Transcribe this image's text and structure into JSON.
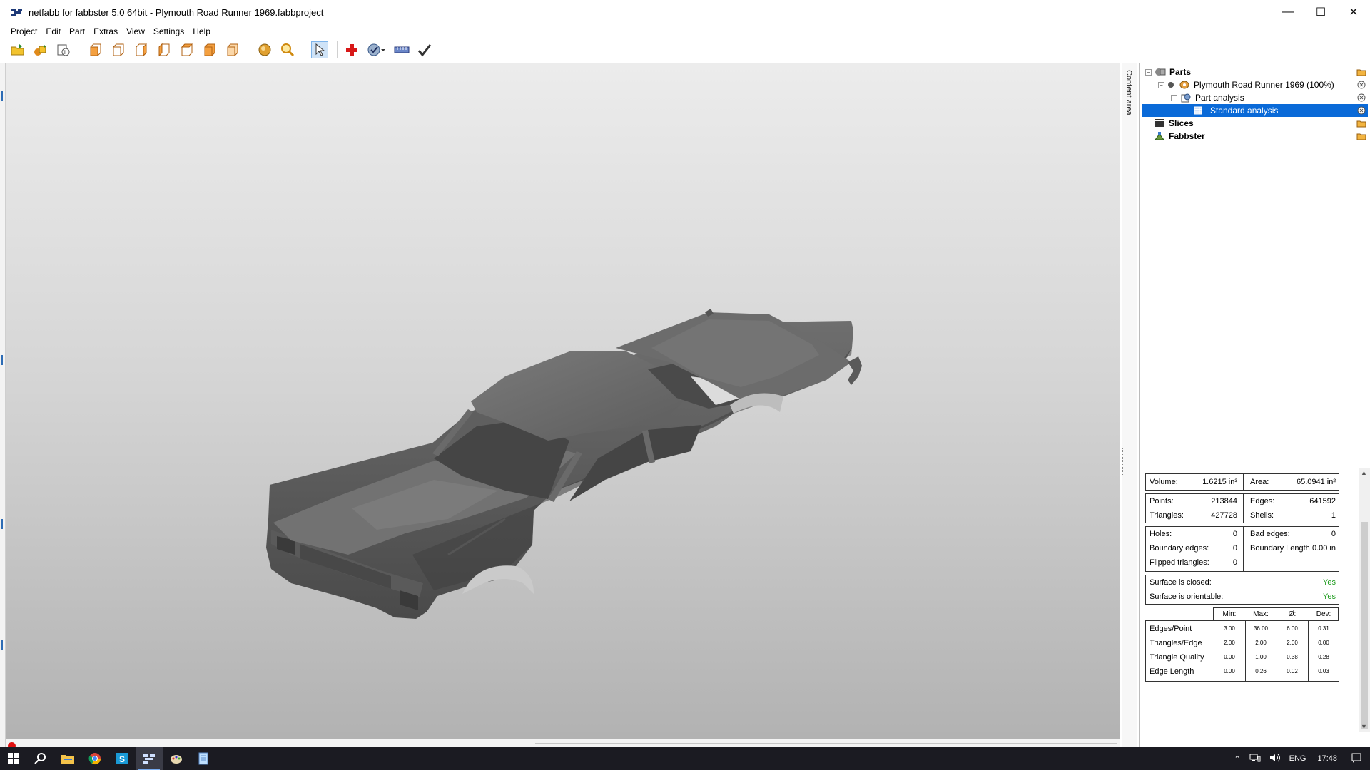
{
  "window": {
    "title": "netfabb for fabbster 5.0 64bit - Plymouth Road Runner 1969.fabbproject",
    "minimize": "—",
    "maximize": "☐",
    "close": "✕"
  },
  "menu": [
    "Project",
    "Edit",
    "Part",
    "Extras",
    "View",
    "Settings",
    "Help"
  ],
  "toolbar_icons": [
    "open-project-icon",
    "add-part-icon",
    "part-info-icon",
    "view-front-icon",
    "view-back-icon",
    "view-left-icon",
    "view-right-icon",
    "view-top-icon",
    "view-bottom-icon",
    "view-iso-icon",
    "shading-icon",
    "zoom-icon",
    "select-tool-icon",
    "repair-icon",
    "measure-icon",
    "ruler-icon",
    "check-icon"
  ],
  "sidetab": {
    "label": "Content area"
  },
  "tree": {
    "parts": "Parts",
    "part_name": "Plymouth Road Runner 1969 (100%)",
    "part_analysis": "Part analysis",
    "standard_analysis": "Standard analysis",
    "slices": "Slices",
    "fabbster": "Fabbster"
  },
  "stats": {
    "volume_label": "Volume:",
    "volume": "1.6215 in³",
    "area_label": "Area:",
    "area": "65.0941 in²",
    "points_label": "Points:",
    "points": "213844",
    "edges_label": "Edges:",
    "edges": "641592",
    "triangles_label": "Triangles:",
    "triangles": "427728",
    "shells_label": "Shells:",
    "shells": "1",
    "holes_label": "Holes:",
    "holes": "0",
    "bad_edges_label": "Bad edges:",
    "bad_edges": "0",
    "boundary_edges_label": "Boundary edges:",
    "boundary_edges": "0",
    "boundary_length_label": "Boundary Length",
    "boundary_length": "0.00 in",
    "flipped_label": "Flipped triangles:",
    "flipped": "0",
    "closed_label": "Surface is closed:",
    "closed": "Yes",
    "orientable_label": "Surface is orientable:",
    "orientable": "Yes",
    "table_headers": [
      "Min:",
      "Max:",
      "Ø:",
      "Dev:"
    ],
    "table_rows": [
      {
        "label": "Edges/Point",
        "values": [
          "3.00",
          "36.00",
          "6.00",
          "0.31"
        ]
      },
      {
        "label": "Triangles/Edge",
        "values": [
          "2.00",
          "2.00",
          "2.00",
          "0.00"
        ]
      },
      {
        "label": "Triangle Quality",
        "values": [
          "0.00",
          "1.00",
          "0.38",
          "0.28"
        ]
      },
      {
        "label": "Edge Length",
        "values": [
          "0.00",
          "0.26",
          "0.02",
          "0.03"
        ]
      }
    ]
  },
  "taskbar": {
    "apps": [
      "start-icon",
      "search-icon",
      "file-explorer-icon",
      "chrome-icon",
      "app-s-icon",
      "netfabb-icon",
      "paint-icon",
      "notepad-icon"
    ],
    "tray_language": "ENG",
    "tray_time": "17:48"
  }
}
